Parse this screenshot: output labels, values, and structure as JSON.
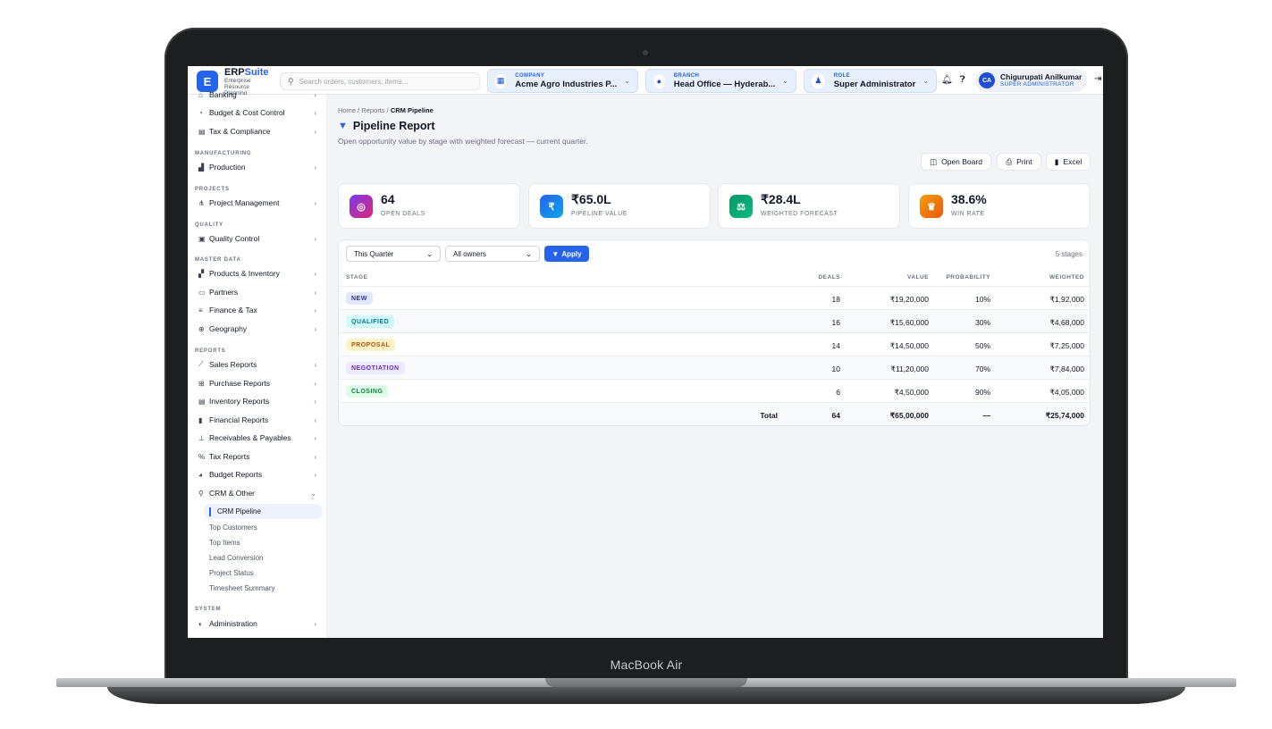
{
  "device_label": "MacBook Air",
  "app": {
    "logo_letter": "E",
    "name_part1": "ERP",
    "name_part2": "Suite",
    "subtitle": "Enterprise Resource Planning"
  },
  "search": {
    "placeholder": "Search orders, customers, items..."
  },
  "context": {
    "company": {
      "label": "COMPANY",
      "value": "Acme Agro Industries P..."
    },
    "branch": {
      "label": "BRANCH",
      "value": "Head Office — Hyderab..."
    },
    "role": {
      "label": "ROLE",
      "value": "Super Administrator"
    }
  },
  "user": {
    "initials": "CA",
    "name": "Chigurupati Anilkumar",
    "role": "SUPER ADMINISTRATOR"
  },
  "sidebar": {
    "top_items": [
      {
        "label": "Banking",
        "icon": "bank-icon"
      },
      {
        "label": "Budget & Cost Control",
        "icon": "pie-icon"
      },
      {
        "label": "Tax & Compliance",
        "icon": "document-icon"
      }
    ],
    "groups": {
      "manufacturing": "MANUFACTURING",
      "projects": "PROJECTS",
      "quality": "QUALITY",
      "master_data": "MASTER DATA",
      "reports": "REPORTS",
      "system": "SYSTEM"
    },
    "items": {
      "production": "Production",
      "project_management": "Project Management",
      "quality_control": "Quality Control",
      "products_inventory": "Products & Inventory",
      "partners": "Partners",
      "finance_tax": "Finance & Tax",
      "geography": "Geography",
      "sales_reports": "Sales Reports",
      "purchase_reports": "Purchase Reports",
      "inventory_reports": "Inventory Reports",
      "financial_reports": "Financial Reports",
      "receivables_payables": "Receivables & Payables",
      "tax_reports": "Tax Reports",
      "budget_reports": "Budget Reports",
      "crm_other": "CRM & Other",
      "administration": "Administration"
    },
    "crm_sub": [
      "CRM Pipeline",
      "Top Customers",
      "Top Items",
      "Lead Conversion",
      "Project Status",
      "Timesheet Summary"
    ]
  },
  "breadcrumb": {
    "home": "Home",
    "sep": "/",
    "reports": "Reports",
    "current": "CRM Pipeline"
  },
  "page": {
    "title": "Pipeline Report",
    "subtitle": "Open opportunity value by stage with weighted forecast — current quarter."
  },
  "actions": {
    "open_board": "Open Board",
    "print": "Print",
    "excel": "Excel"
  },
  "kpis": [
    {
      "value": "64",
      "label": "OPEN DEALS",
      "icon": "target-icon",
      "color": "#a21caf"
    },
    {
      "value": "₹65.0L",
      "label": "PIPELINE VALUE",
      "icon": "rupee-icon",
      "color": "#2563eb"
    },
    {
      "value": "₹28.4L",
      "label": "WEIGHTED FORECAST",
      "icon": "scale-icon",
      "color": "#059669"
    },
    {
      "value": "38.6%",
      "label": "WIN RATE",
      "icon": "trophy-icon",
      "color": "#f59e0b"
    }
  ],
  "filters": {
    "period": "This Quarter",
    "owner": "All owners",
    "apply_label": "Apply",
    "stage_count": "5 stages"
  },
  "table": {
    "headers": {
      "stage": "STAGE",
      "deals": "DEALS",
      "value": "VALUE",
      "probability": "PROBABILITY",
      "weighted": "WEIGHTED"
    },
    "rows": [
      {
        "stage": "NEW",
        "deals": "18",
        "value": "₹19,20,000",
        "probability": "10%",
        "weighted": "₹1,92,000",
        "bg": "#e0e7ff",
        "fg": "#3730a3"
      },
      {
        "stage": "QUALIFIED",
        "deals": "16",
        "value": "₹15,60,000",
        "probability": "30%",
        "weighted": "₹4,68,000",
        "bg": "#cffafe",
        "fg": "#0e7490"
      },
      {
        "stage": "PROPOSAL",
        "deals": "14",
        "value": "₹14,50,000",
        "probability": "50%",
        "weighted": "₹7,25,000",
        "bg": "#fef3c7",
        "fg": "#b45309"
      },
      {
        "stage": "NEGOTIATION",
        "deals": "10",
        "value": "₹11,20,000",
        "probability": "70%",
        "weighted": "₹7,84,000",
        "bg": "#ede9fe",
        "fg": "#6d28d9"
      },
      {
        "stage": "CLOSING",
        "deals": "6",
        "value": "₹4,50,000",
        "probability": "90%",
        "weighted": "₹4,05,000",
        "bg": "#dcfce7",
        "fg": "#15803d"
      }
    ],
    "total": {
      "label": "Total",
      "deals": "64",
      "value": "₹65,00,000",
      "probability": "—",
      "weighted": "₹25,74,000"
    }
  }
}
